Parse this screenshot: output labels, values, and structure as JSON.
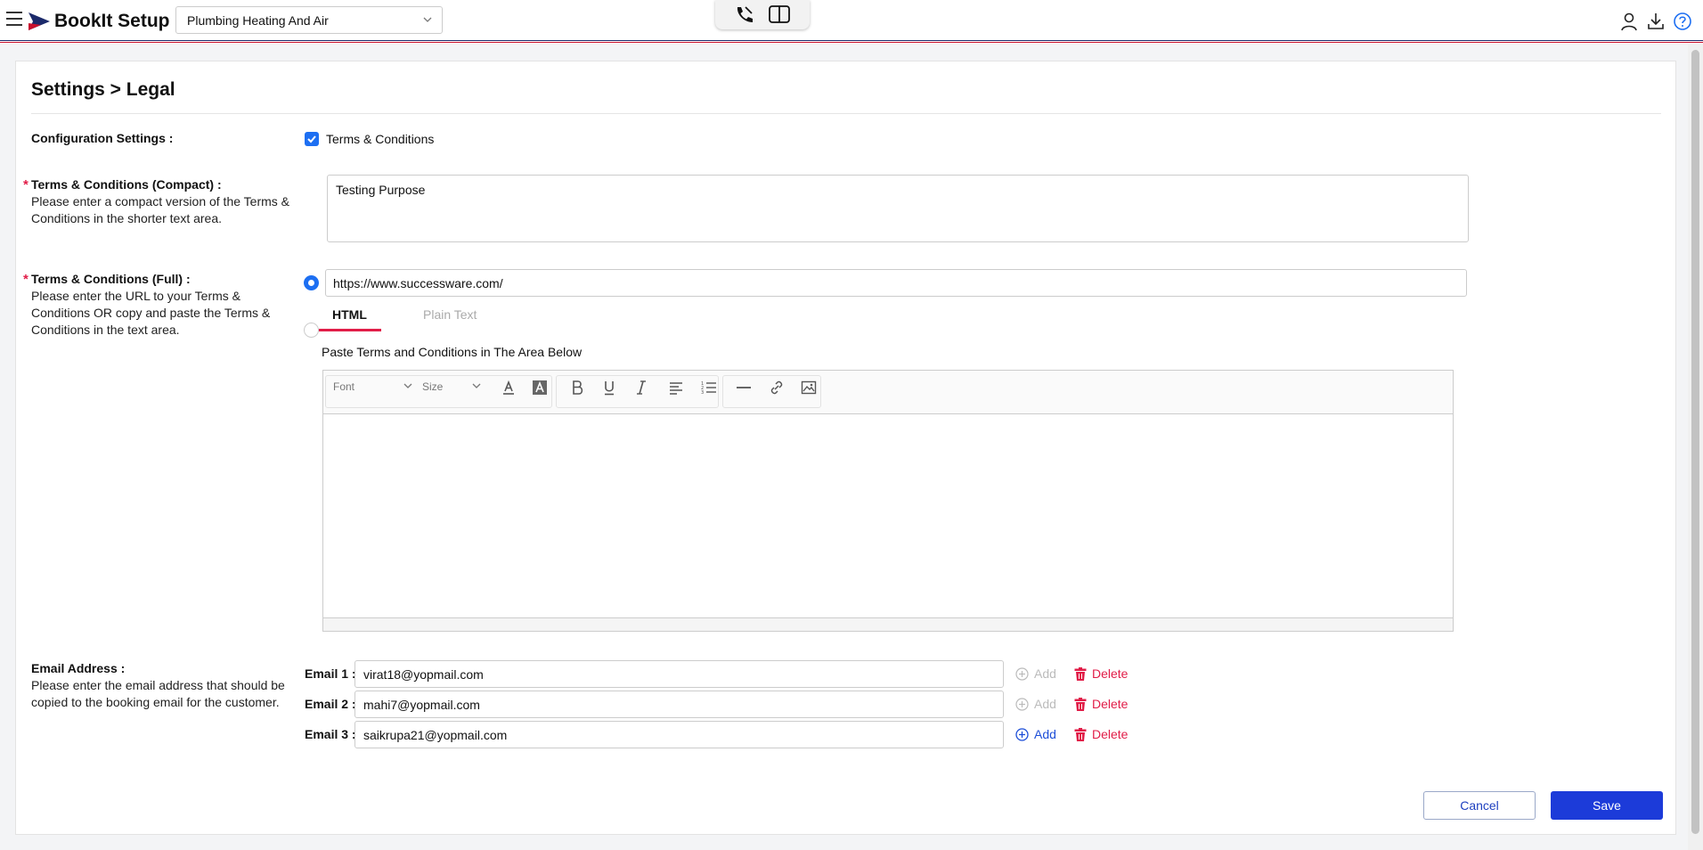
{
  "header": {
    "app_title": "BookIt Setup",
    "company_selected": "Plumbing Heating And Air"
  },
  "page": {
    "title": "Settings > Legal"
  },
  "config": {
    "label": "Configuration Settings :",
    "checkbox_label": "Terms & Conditions",
    "checked": true
  },
  "compact": {
    "label": "Terms & Conditions (Compact) :",
    "help_line1": "Please enter a compact version of the Terms &",
    "help_line2": "Conditions in the shorter text area.",
    "value": "Testing Purpose"
  },
  "full": {
    "label": "Terms & Conditions (Full) :",
    "help_line1": "Please enter the URL to your Terms &",
    "help_line2": "Conditions OR copy and paste the Terms &",
    "help_line3": "Conditions in the text area.",
    "url_value": "https://www.successware.com/",
    "tab_html": "HTML",
    "tab_plain": "Plain Text",
    "paste_label": "Paste Terms and Conditions in The Area Below",
    "toolbar_font": "Font",
    "toolbar_size": "Size"
  },
  "email": {
    "label": "Email Address :",
    "help_line1": "Please enter the email address that should be",
    "help_line2": "copied to the booking email for the customer.",
    "rows": [
      {
        "label": "Email 1 :",
        "value": "virat18@yopmail.com",
        "add": "Add",
        "delete": "Delete"
      },
      {
        "label": "Email 2 :",
        "value": "mahi7@yopmail.com",
        "add": "Add",
        "delete": "Delete"
      },
      {
        "label": "Email 3 :",
        "value": "saikrupa21@yopmail.com",
        "add": "Add",
        "delete": "Delete"
      }
    ]
  },
  "actions": {
    "cancel": "Cancel",
    "save": "Save"
  },
  "colors": {
    "accent": "#1d6ff2",
    "primary_button": "#1c3bd9",
    "danger": "#e11d48"
  }
}
